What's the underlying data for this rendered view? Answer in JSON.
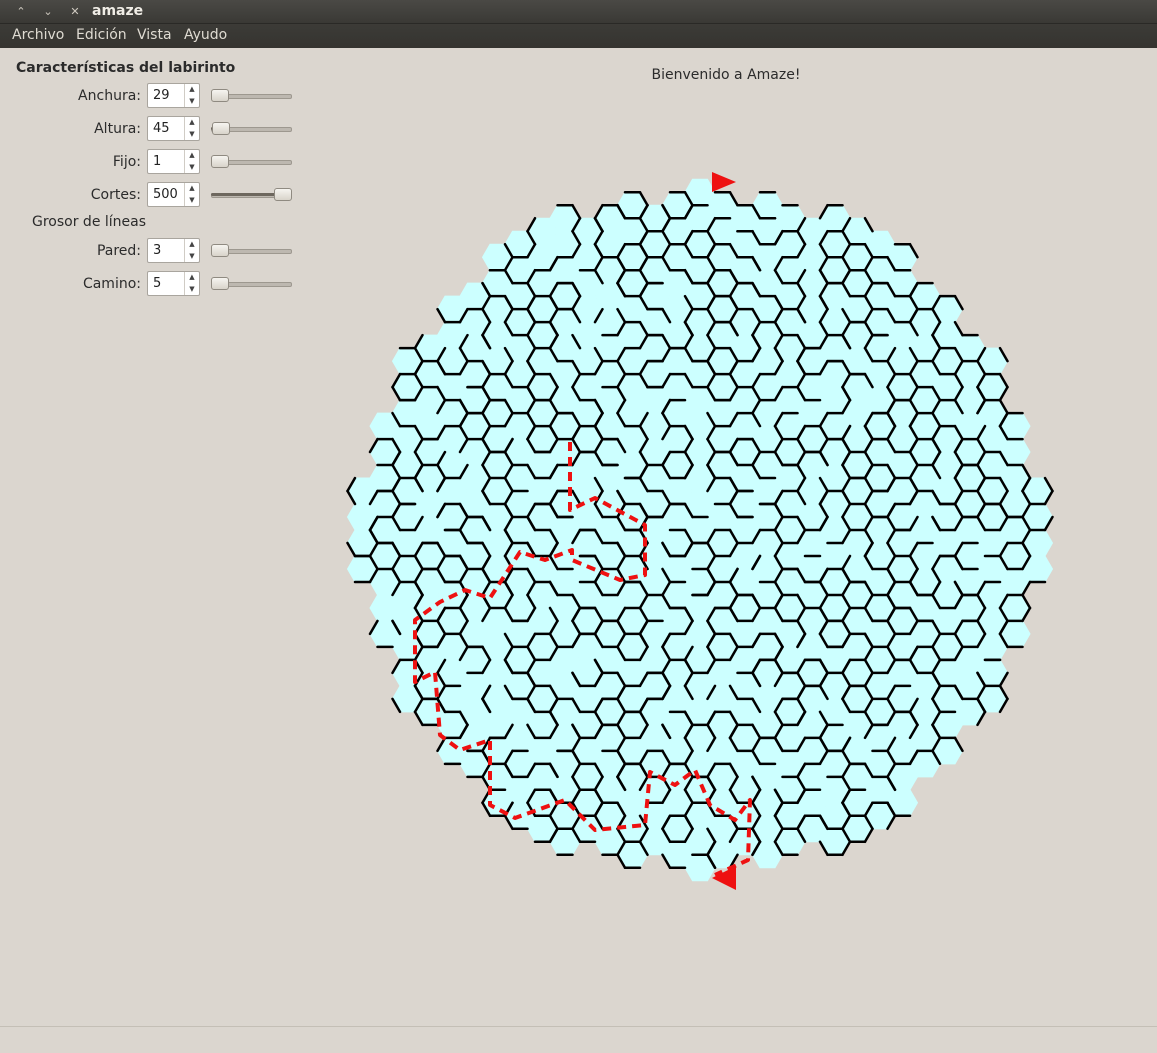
{
  "window": {
    "title": "amaze",
    "controls": [
      "chevron-up-icon",
      "chevron-down-icon",
      "close-icon"
    ]
  },
  "menubar": {
    "items": [
      "Archivo",
      "Edición",
      "Vista",
      "Ayudo"
    ]
  },
  "panel": {
    "title": "Características del labirinto",
    "rows": [
      {
        "label": "Anchura:",
        "value": "29",
        "slider_fraction": 0.0
      },
      {
        "label": "Altura:",
        "value": "45",
        "slider_fraction": 0.02
      },
      {
        "label": "Fijo:",
        "value": "1",
        "slider_fraction": 0.0
      },
      {
        "label": "Cortes:",
        "value": "500",
        "slider_fraction": 1.0
      }
    ],
    "section": "Grosor de líneas",
    "thickness_rows": [
      {
        "label": "Pared:",
        "value": "3",
        "slider_fraction": 0.0
      },
      {
        "label": "Camino:",
        "value": "5",
        "slider_fraction": 0.0
      }
    ]
  },
  "main": {
    "welcome": "Bienvenido a Amaze!"
  },
  "maze": {
    "fill_color": "#ccffff",
    "wall_color": "#000000",
    "path_color": "#ee1111",
    "start_marker": "play-arrow-icon",
    "end_marker": "play-arrow-icon"
  }
}
